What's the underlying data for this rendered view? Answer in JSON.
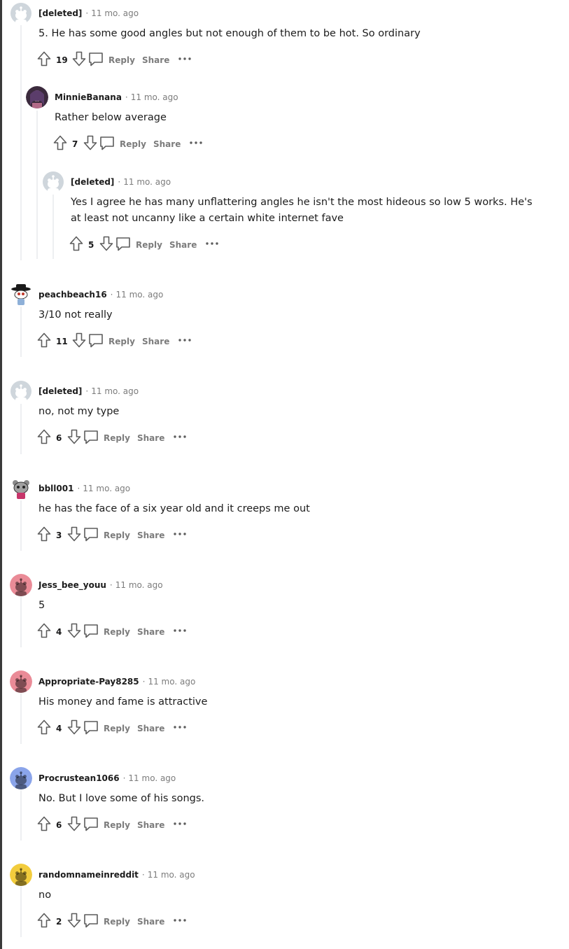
{
  "comments": [
    {
      "author": "[deleted]",
      "age": "11 mo. ago",
      "body": [
        "5. He has some good angles but not enough of them to be hot. So ordinary"
      ],
      "votes": "19",
      "avatar": "deleted-avatar"
    },
    {
      "author": "MinnieBanana",
      "age": "11 mo. ago",
      "body": [
        "Rather below average"
      ],
      "votes": "7",
      "avatar": "photo-avatar"
    },
    {
      "author": "[deleted]",
      "age": "11 mo. ago",
      "body": [
        "Yes I agree he has many unflattering angles he isn't the most hideous so low 5 works. He's",
        "at least not uncanny like a certain white internet fave"
      ],
      "votes": "5",
      "avatar": "deleted-avatar"
    },
    {
      "author": "peachbeach16",
      "age": "11 mo. ago",
      "body": [
        "3/10 not really"
      ],
      "votes": "11",
      "avatar": "snoo-hat-avatar"
    },
    {
      "author": "[deleted]",
      "age": "11 mo. ago",
      "body": [
        "no, not my type"
      ],
      "votes": "6",
      "avatar": "deleted-avatar"
    },
    {
      "author": "bbll001",
      "age": "11 mo. ago",
      "body": [
        "he has the face of a six year old and it creeps me out"
      ],
      "votes": "3",
      "avatar": "snoo-bear-avatar"
    },
    {
      "author": "Jess_bee_youu",
      "age": "11 mo. ago",
      "body": [
        "5"
      ],
      "votes": "4",
      "avatar": "default-snoo-pink"
    },
    {
      "author": "Appropriate-Pay8285",
      "age": "11 mo. ago",
      "body": [
        "His money and fame is attractive"
      ],
      "votes": "4",
      "avatar": "default-snoo-pink"
    },
    {
      "author": "Procrustean1066",
      "age": "11 mo. ago",
      "body": [
        "No. But I love some of his songs."
      ],
      "votes": "6",
      "avatar": "default-snoo-blue"
    },
    {
      "author": "randomnameinreddit",
      "age": "11 mo. ago",
      "body": [
        "no"
      ],
      "votes": "2",
      "avatar": "default-snoo-yellow"
    }
  ],
  "actions": {
    "separator": "·",
    "reply_label": "Reply",
    "share_label": "Share"
  },
  "colors": {
    "pink": "#ea8b97",
    "blue": "#8aa4ea",
    "yellow": "#f2cc3d",
    "deleted": "#cfd6dc",
    "meta": "#7c7c7c",
    "thread": "#edeff1"
  }
}
